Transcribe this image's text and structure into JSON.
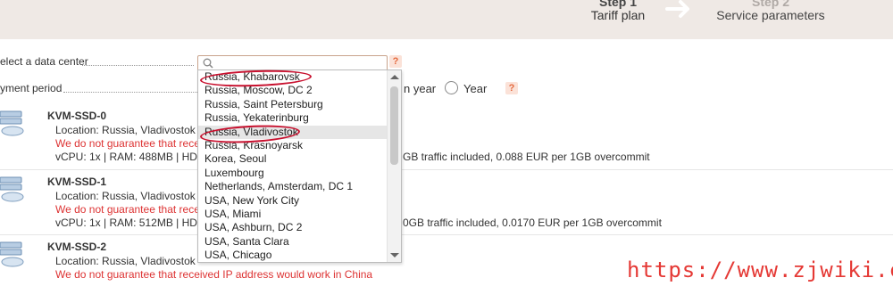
{
  "steps": [
    {
      "number": "Step 1",
      "label": "Tariff plan"
    },
    {
      "number": "Step 2",
      "label": "Service parameters"
    }
  ],
  "form": {
    "datacenter_label": "elect a data center",
    "period_label": "yment period",
    "help_glyph": "?",
    "period_options": [
      {
        "label": "n year"
      },
      {
        "label": "Year"
      }
    ]
  },
  "dropdown": {
    "items": [
      "Russia, Khabarovsk",
      "Russia, Moscow, DC 2",
      "Russia, Saint Petersburg",
      "Russia, Yekaterinburg",
      "Russia, Vladivostok",
      "Russia, Krasnoyarsk",
      "Korea, Seoul",
      "Luxembourg",
      "Netherlands, Amsterdam, DC 1",
      "USA, New York City",
      "USA, Miami",
      "USA, Ashburn, DC 2",
      "USA, Santa Clara",
      "USA, Chicago"
    ],
    "highlighted": "Russia, Vladivostok"
  },
  "plans": [
    {
      "name": "KVM-SSD-0",
      "location": "Location: Russia, Vladivostok",
      "warning": "We do not guarantee that receiv",
      "spec": "vCPU: 1x | RAM: 488MB | HDD",
      "traffic": "GB traffic included, 0.088 EUR per 1GB overcommit"
    },
    {
      "name": "KVM-SSD-1",
      "location": "Location: Russia, Vladivostok",
      "warning": "We do not guarantee that receiv",
      "spec": "vCPU: 1x | RAM: 512MB | HDD",
      "traffic": "0GB traffic included, 0.0170 EUR per 1GB overcommit"
    },
    {
      "name": "KVM-SSD-2",
      "location": "Location: Russia, Vladivostok",
      "warning": "We do not guarantee that received IP address would work in China",
      "spec": "",
      "traffic": ""
    }
  ],
  "watermark": "https://www.zjwiki.com",
  "colors": {
    "header_bg": "#efe9e5",
    "warning": "#dd3333",
    "annotation": "#c8102e",
    "watermark": "#e53935"
  }
}
